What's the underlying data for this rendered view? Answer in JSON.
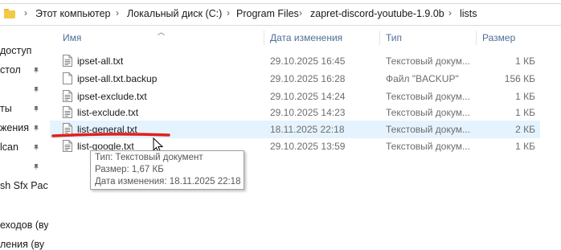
{
  "breadcrumb": {
    "items": [
      {
        "label": "Этот компьютер"
      },
      {
        "label": "Локальный диск (C:)"
      },
      {
        "label": "Program Files"
      },
      {
        "label": "zapret-discord-youtube-1.9.0b"
      },
      {
        "label": "lists"
      }
    ]
  },
  "sidebar": {
    "items": [
      {
        "label": "доступ",
        "pinned": false
      },
      {
        "label": "стол",
        "pinned": true
      },
      {
        "label": "",
        "pinned": true
      },
      {
        "label": "ты",
        "pinned": true
      },
      {
        "label": "жения",
        "pinned": true
      },
      {
        "label": "lcan",
        "pinned": true
      },
      {
        "label": "",
        "pinned": true
      },
      {
        "label": "sh Sfx Pac",
        "pinned": false
      },
      {
        "label": "",
        "pinned": false
      },
      {
        "label": "еходов (ву",
        "pinned": false
      },
      {
        "label": "ления (ву",
        "pinned": false
      }
    ]
  },
  "columns": {
    "name": "Имя",
    "date": "Дата изменения",
    "type": "Тип",
    "size": "Размер"
  },
  "files": [
    {
      "name": "ipset-all.txt",
      "date": "29.10.2025 16:45",
      "type": "Текстовый докум...",
      "size": "1 КБ"
    },
    {
      "name": "ipset-all.txt.backup",
      "date": "29.10.2025 16:28",
      "type": "Файл \"BACKUP\"",
      "size": "156 КБ"
    },
    {
      "name": "ipset-exclude.txt",
      "date": "29.10.2025 14:24",
      "type": "Текстовый докум...",
      "size": "1 КБ"
    },
    {
      "name": "list-exclude.txt",
      "date": "29.10.2025 14:23",
      "type": "Текстовый докум...",
      "size": "1 КБ"
    },
    {
      "name": "list-general.txt",
      "date": "18.11.2025 22:18",
      "type": "Текстовый докум...",
      "size": "2 КБ"
    },
    {
      "name": "list-google.txt",
      "date": "29.10.2025 13:59",
      "type": "Текстовый докум...",
      "size": "1 КБ"
    }
  ],
  "tooltip": {
    "type_line": "Тип: Текстовый документ",
    "size_line": "Размер: 1,67 КБ",
    "date_line": "Дата изменения: 18.11.2025 22:18"
  },
  "colors": {
    "hover_row": "#e5f3ff",
    "annotation": "#e0201c",
    "header_text": "#4d6f96"
  }
}
